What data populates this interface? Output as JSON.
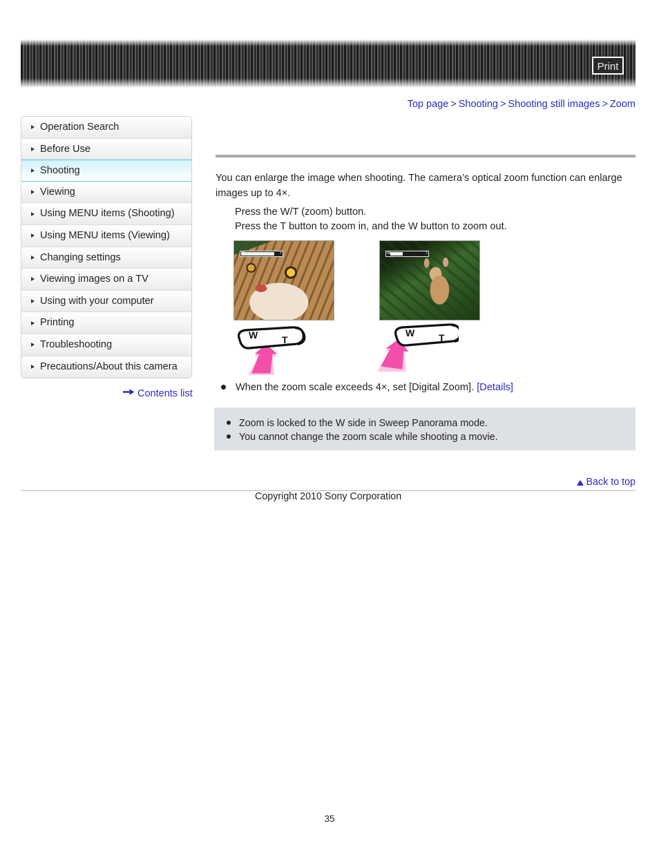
{
  "header": {
    "print_label": "Print"
  },
  "breadcrumb": {
    "items": [
      {
        "label": "Top page"
      },
      {
        "label": "Shooting"
      },
      {
        "label": "Shooting still images"
      },
      {
        "label": "Zoom"
      }
    ],
    "separator": ">"
  },
  "sidebar": {
    "items": [
      {
        "label": "Operation Search",
        "active": false
      },
      {
        "label": "Before Use",
        "active": false
      },
      {
        "label": "Shooting",
        "active": true
      },
      {
        "label": "Viewing",
        "active": false
      },
      {
        "label": "Using MENU items (Shooting)",
        "active": false
      },
      {
        "label": "Using MENU items (Viewing)",
        "active": false
      },
      {
        "label": "Changing settings",
        "active": false
      },
      {
        "label": "Viewing images on a TV",
        "active": false
      },
      {
        "label": "Using with your computer",
        "active": false
      },
      {
        "label": "Printing",
        "active": false
      },
      {
        "label": "Troubleshooting",
        "active": false
      },
      {
        "label": "Precautions/About this camera",
        "active": false
      }
    ],
    "contents_list_label": "Contents list"
  },
  "main": {
    "lead_paragraph": "You can enlarge the image when shooting. The camera’s optical zoom function can enlarge images up to 4×.",
    "step_line_1": "Press the W/T (zoom) button.",
    "step_line_2": "Press the T button to zoom in, and the W button to zoom out.",
    "detail_bullet": {
      "text": "When the zoom scale exceeds 4×, set [Digital Zoom].",
      "link_label": "[Details]"
    },
    "figures": {
      "left": {
        "caption": "",
        "zoom_side": "T",
        "w_label": "W",
        "t_label": "T"
      },
      "right": {
        "caption": "",
        "zoom_side": "W",
        "w_label": "W",
        "t_label": "T"
      }
    },
    "notes": [
      "Zoom is locked to the W side in Sweep Panorama mode.",
      "You cannot change the zoom scale while shooting a movie."
    ]
  },
  "footer": {
    "back_to_top_label": "Back to top",
    "copyright": "Copyright 2010 Sony Corporation",
    "page_number": "35"
  },
  "colors": {
    "link": "#2b2bbd",
    "active_nav_border": "#57c8e8",
    "note_box_bg": "#dde0e4",
    "arrow_pink": "#ef3fa0"
  }
}
